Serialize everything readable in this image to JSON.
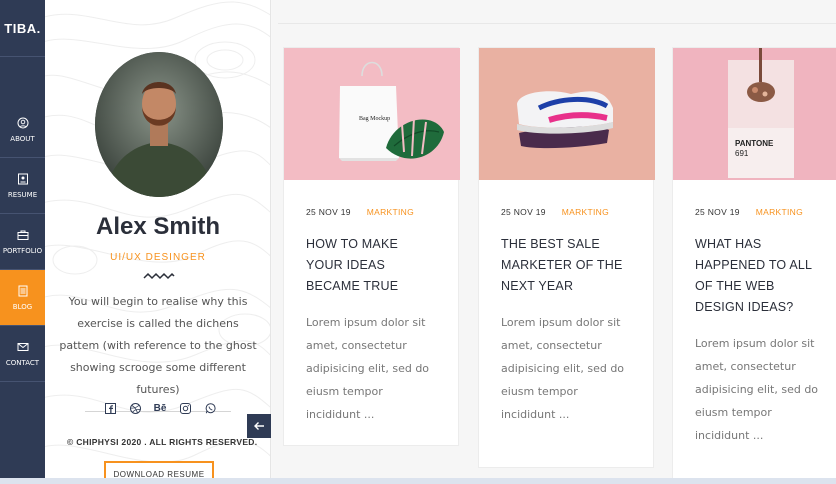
{
  "brand": "TIBA.",
  "nav": [
    {
      "label": "ABOUT",
      "icon": "user-icon"
    },
    {
      "label": "RESUME",
      "icon": "id-card-icon"
    },
    {
      "label": "PORTFOLIO",
      "icon": "briefcase-icon"
    },
    {
      "label": "BLOG",
      "icon": "document-icon"
    },
    {
      "label": "CONTACT",
      "icon": "envelope-icon"
    }
  ],
  "active_nav": "BLOG",
  "profile": {
    "name": "Alex Smith",
    "role": "UI/UX DESINGER",
    "bio": "You will begin to realise why this exercise is called the dichens pattem (with reference to the ghost showing scrooge some different futures)",
    "socials": [
      "facebook-icon",
      "dribbble-icon",
      "behance-icon",
      "instagram-icon",
      "whatsapp-icon"
    ],
    "behance_text": "Bē",
    "copyright": "© CHIPHYSI 2020 . ALL RIGHTS RESERVED.",
    "download_label": "DOWNLOAD RESUME"
  },
  "posts": [
    {
      "date": "25 NOV 19",
      "category": "MARKTING",
      "title": "HOW TO MAKE YOUR IDEAS BECAME TRUE",
      "excerpt": "Lorem ipsum dolor sit amet, consectetur adipisicing elit, sed do eiusm tempor incididunt ...",
      "image_text": "Bag Mockup"
    },
    {
      "date": "25 NOV 19",
      "category": "MARKTING",
      "title": "THE BEST SALE MARKETER OF THE NEXT YEAR",
      "excerpt": "Lorem ipsum dolor sit amet, consectetur adipisicing elit, sed do eiusm tempor incididunt ..."
    },
    {
      "date": "25 NOV 19",
      "category": "MARKTING",
      "title": "WHAT HAS HAPPENED TO ALL OF THE WEB DESIGN IDEAS?",
      "excerpt": "Lorem ipsum dolor sit amet, consectetur adipisicing elit, sed do eiusm tempor incididunt ...",
      "image_text": "PANTONE 691"
    }
  ],
  "colors": {
    "nav_bg": "#2f3b55",
    "accent": "#f7921e",
    "text_dark": "#2b2f3a"
  }
}
